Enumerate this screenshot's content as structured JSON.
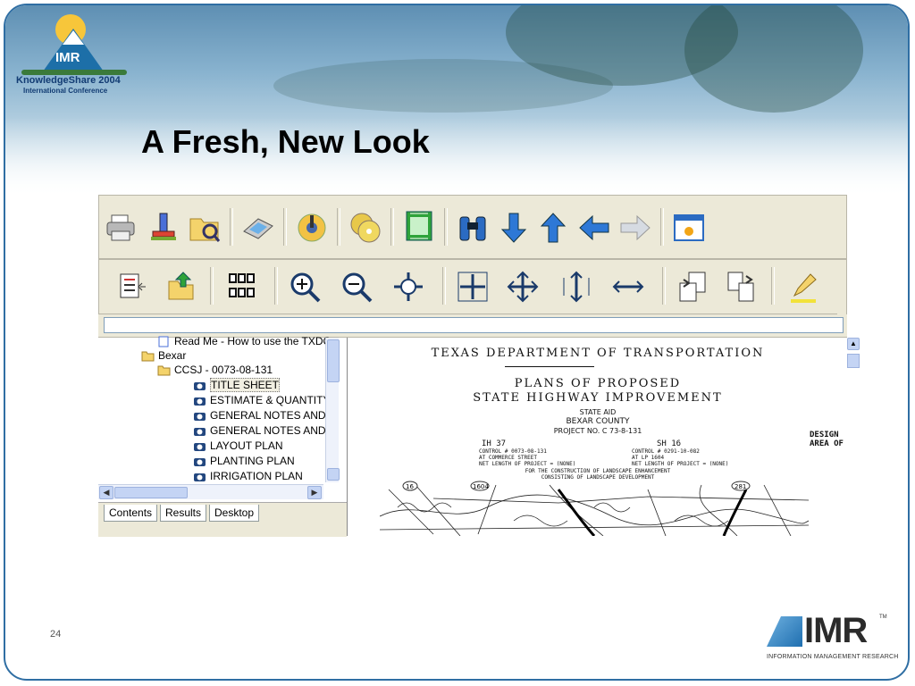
{
  "logo": {
    "mark_text": "IMR",
    "line1": "KnowledgeShare 2004",
    "line2": "International Conference"
  },
  "title": "A Fresh, New Look",
  "toolbar1": {
    "icons": [
      "print-icon",
      "stamp-icon",
      "open-folder-icon",
      "scanner-icon",
      "wizard-icon",
      "cd-icon",
      "page-range-icon",
      "find-binoculars-icon",
      "arrow-down-icon",
      "arrow-up-icon",
      "arrow-left-icon",
      "arrow-right-icon",
      "window-icon"
    ]
  },
  "toolbar2": {
    "icons": [
      "list-view-icon",
      "export-icon",
      "thumbnails-icon",
      "zoom-in-icon",
      "zoom-out-icon",
      "pan-icon",
      "fit-page-icon",
      "fit-both-icon",
      "fit-height-icon",
      "fit-width-icon",
      "page-copy-icon",
      "page-compare-icon",
      "pencil-icon"
    ]
  },
  "tree": {
    "items": [
      {
        "label": "Read Me - How to use the TXDO",
        "icon": "document-icon"
      },
      {
        "label": "Bexar",
        "icon": "folder-icon"
      },
      {
        "label": "CCSJ - 0073-08-131",
        "icon": "folder-icon"
      },
      {
        "label": "TITLE SHEET",
        "icon": "camera-icon"
      },
      {
        "label": "ESTIMATE & QUANTITY",
        "icon": "camera-icon"
      },
      {
        "label": "GENERAL NOTES AND SI",
        "icon": "camera-icon"
      },
      {
        "label": "GENERAL NOTES AND SI",
        "icon": "camera-icon"
      },
      {
        "label": "LAYOUT PLAN",
        "icon": "camera-icon"
      },
      {
        "label": "PLANTING PLAN",
        "icon": "camera-icon"
      },
      {
        "label": "IRRIGATION PLAN",
        "icon": "camera-icon"
      }
    ]
  },
  "tabs": [
    "Contents",
    "Results",
    "Desktop"
  ],
  "document": {
    "header": "TEXAS DEPARTMENT OF TRANSPORTATION",
    "plans_line1": "PLANS OF PROPOSED",
    "plans_line2": "STATE HIGHWAY IMPROVEMENT",
    "state_aid": "STATE AID",
    "county": "BEXAR COUNTY",
    "project": "PROJECT NO. C 73-8-131",
    "left_route": "IH 37",
    "left_control": "CONTROL # 0073-08-131",
    "left_at": "AT COMMERCE STREET",
    "left_net": "NET LENGTH OF PROJECT = (NONE)",
    "right_route": "SH 16",
    "right_control": "CONTROL # 0291-10-082",
    "right_at": "AT LP 1604",
    "right_net": "NET LENGTH OF PROJECT = (NONE)",
    "construction1": "FOR THE CONSTRUCTION OF LANDSCAPE ENHANCEMENT",
    "construction2": "CONSISTING OF LANDSCAPE DEVELOPMENT",
    "map_labels": [
      "16",
      "1604",
      "281"
    ]
  },
  "right_note": {
    "line1": "DESIGN",
    "line2": "AREA OF"
  },
  "page_number": "24",
  "imr": {
    "mark": "IMR",
    "tm": "TM",
    "subtitle": "INFORMATION MANAGEMENT RESEARCH"
  },
  "colors": {
    "border": "#2f6ea3",
    "toolbar_bg": "#ece9d8",
    "arrow_blue": "#2e78d6",
    "icon_green": "#2fa33a"
  }
}
